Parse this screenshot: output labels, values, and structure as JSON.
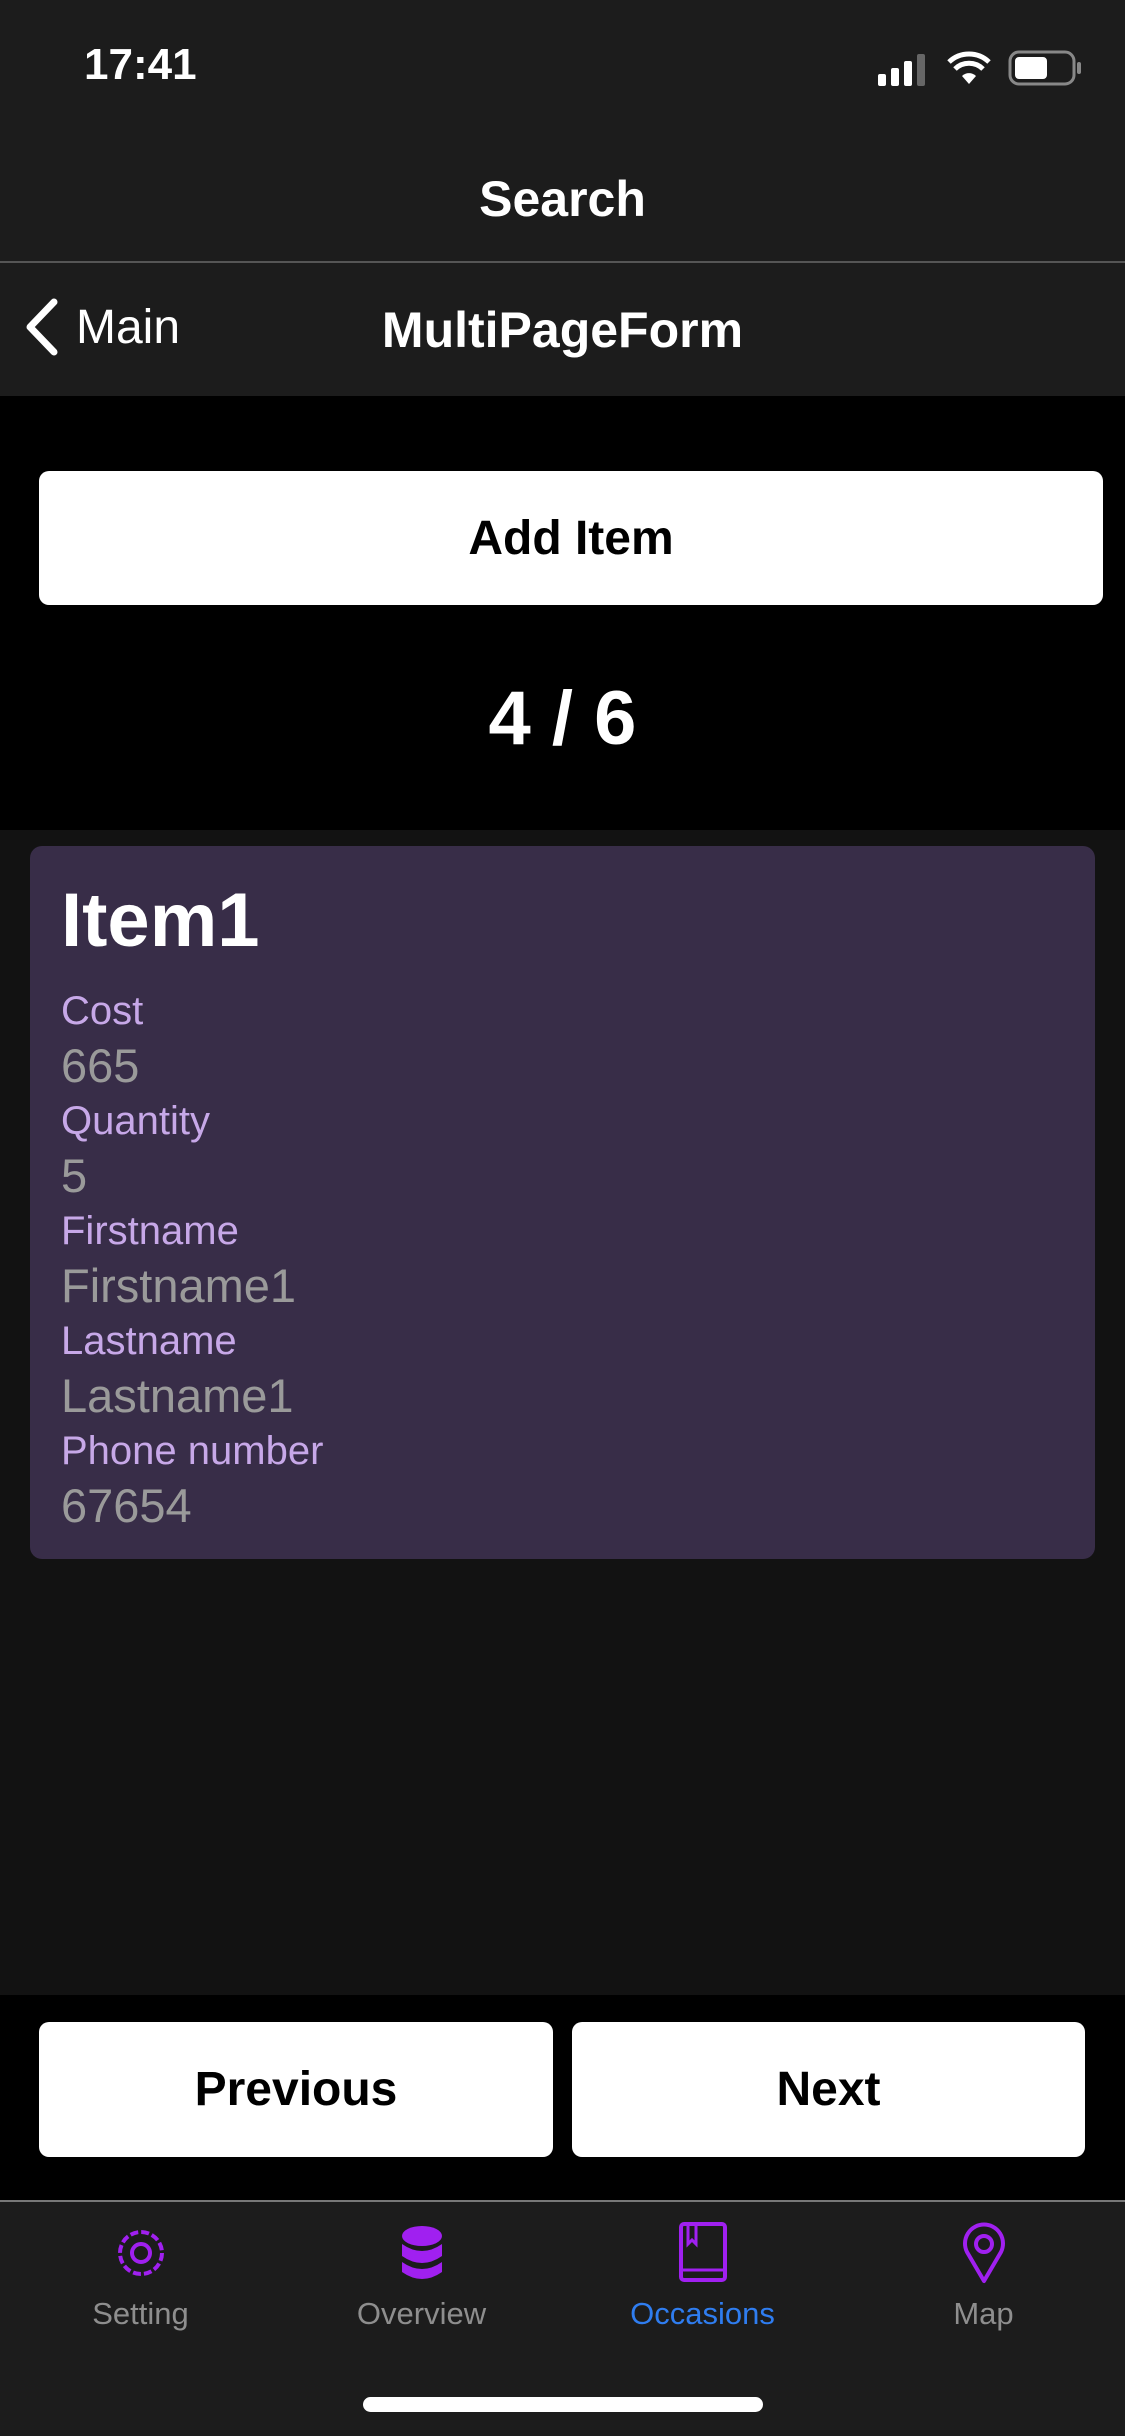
{
  "status_bar": {
    "time": "17:41"
  },
  "header": {
    "title": "Search",
    "back_label": "Main",
    "page_title": "MultiPageForm"
  },
  "main": {
    "add_button": "Add Item",
    "pager": "4 / 6",
    "card": {
      "title": "Item1",
      "fields": [
        {
          "label": "Cost",
          "value": "665"
        },
        {
          "label": "Quantity",
          "value": "5"
        },
        {
          "label": "Firstname",
          "value": "Firstname1"
        },
        {
          "label": "Lastname",
          "value": "Lastname1"
        },
        {
          "label": "Phone number",
          "value": "67654"
        }
      ]
    },
    "previous_button": "Previous",
    "next_button": "Next"
  },
  "tabs": [
    {
      "label": "Setting",
      "icon": "gear-icon"
    },
    {
      "label": "Overview",
      "icon": "database-icon"
    },
    {
      "label": "Occasions",
      "icon": "book-icon",
      "active": true
    },
    {
      "label": "Map",
      "icon": "map-pin-icon"
    }
  ],
  "colors": {
    "accent_icon": "#a020f0",
    "active_tab": "#2f7df0",
    "card": "#382d48",
    "label": "#c7a8e8"
  }
}
